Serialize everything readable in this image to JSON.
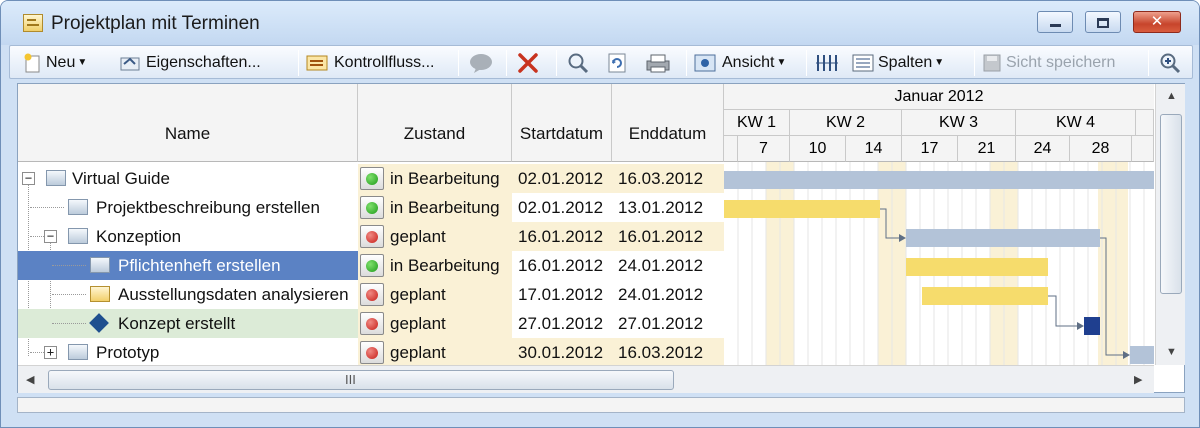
{
  "window": {
    "title": "Projektplan mit Terminen",
    "controls": {
      "minimize": "minimize",
      "maximize": "maximize",
      "close": "✕"
    }
  },
  "toolbar": {
    "new_label": "Neu",
    "properties_label": "Eigenschaften...",
    "control_flow_label": "Kontrollfluss...",
    "view_label": "Ansicht",
    "columns_label": "Spalten",
    "save_view_label": "Sicht speichern"
  },
  "columns": {
    "name": "Name",
    "state": "Zustand",
    "start": "Startdatum",
    "end": "Enddatum"
  },
  "timeline": {
    "month": "Januar 2012",
    "weeks": [
      "KW 1",
      "KW 2",
      "KW 3",
      "KW 4"
    ],
    "days": [
      "7",
      "10",
      "14",
      "17",
      "21",
      "24",
      "28"
    ]
  },
  "rows": [
    {
      "name": "Virtual Guide",
      "state": "in Bearbeitung",
      "status": "green",
      "start": "02.01.2012",
      "end": "16.03.2012",
      "expander": "−"
    },
    {
      "name": "Projektbeschreibung erstellen",
      "state": "in Bearbeitung",
      "status": "green",
      "start": "02.01.2012",
      "end": "13.01.2012"
    },
    {
      "name": "Konzeption",
      "state": "geplant",
      "status": "red",
      "start": "16.01.2012",
      "end": "16.01.2012",
      "expander": "−"
    },
    {
      "name": "Pflichtenheft erstellen",
      "state": "in Bearbeitung",
      "status": "green",
      "start": "16.01.2012",
      "end": "24.01.2012"
    },
    {
      "name": "Ausstellungsdaten analysieren",
      "state": "geplant",
      "status": "red",
      "start": "17.01.2012",
      "end": "24.01.2012"
    },
    {
      "name": "Konzept erstellt",
      "state": "geplant",
      "status": "red",
      "start": "27.01.2012",
      "end": "27.01.2012"
    },
    {
      "name": "Prototyp",
      "state": "geplant",
      "status": "red",
      "start": "30.01.2012",
      "end": "16.03.2012",
      "expander": "+"
    }
  ],
  "scrollbar": {
    "grip": "III"
  },
  "colors": {
    "summary_bar": "#b3c3d8",
    "task_bar": "#f6dc6c",
    "milestone": "#1f3f8f",
    "selected_row": "#5b82c4",
    "weekend": "#faf1d6",
    "status_green": "#1e9b1a",
    "status_red": "#c81e18"
  }
}
